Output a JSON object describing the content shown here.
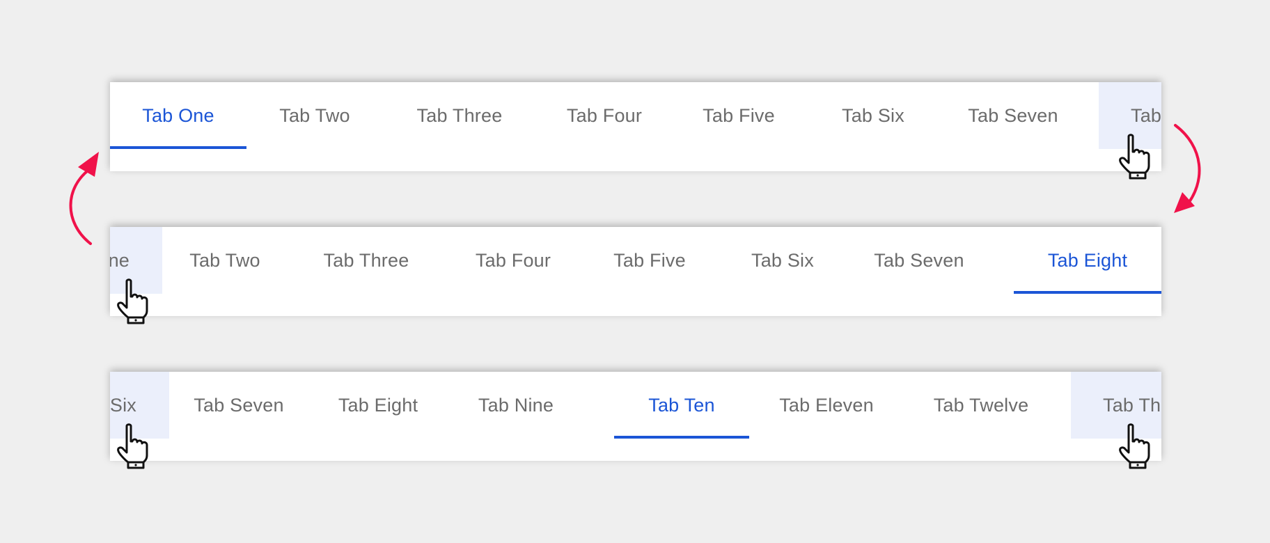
{
  "rows": [
    {
      "tabs": [
        {
          "label": "Tab One",
          "state": "active"
        },
        {
          "label": "Tab Two"
        },
        {
          "label": "Tab Three"
        },
        {
          "label": "Tab Four"
        },
        {
          "label": "Tab Five"
        },
        {
          "label": "Tab Six"
        },
        {
          "label": "Tab Seven"
        },
        {
          "label": "Tab",
          "state": "hovered-edge"
        }
      ]
    },
    {
      "tabs": [
        {
          "label": "ne",
          "state": "hovered-edge"
        },
        {
          "label": "Tab Two"
        },
        {
          "label": "Tab Three"
        },
        {
          "label": "Tab Four"
        },
        {
          "label": "Tab Five"
        },
        {
          "label": "Tab Six"
        },
        {
          "label": "Tab Seven"
        },
        {
          "label": "Tab Eight",
          "state": "active"
        }
      ]
    },
    {
      "tabs": [
        {
          "label": "Six",
          "state": "hovered-edge"
        },
        {
          "label": "Tab Seven"
        },
        {
          "label": "Tab Eight"
        },
        {
          "label": "Tab Nine"
        },
        {
          "label": "Tab Ten",
          "state": "active"
        },
        {
          "label": "Tab Eleven"
        },
        {
          "label": "Tab Twelve"
        },
        {
          "label": "Tab Th",
          "state": "hovered-edge"
        }
      ]
    }
  ],
  "colors": {
    "active": "#1b55d6",
    "inactive_text": "#6b6b6b",
    "edge_hover": "#ebeffb",
    "arrow": "#f0124a",
    "background": "#efefef"
  },
  "icons": {
    "cursor": "hand-pointer-icon",
    "scroll_indicator": "curved-arrow-icon"
  }
}
